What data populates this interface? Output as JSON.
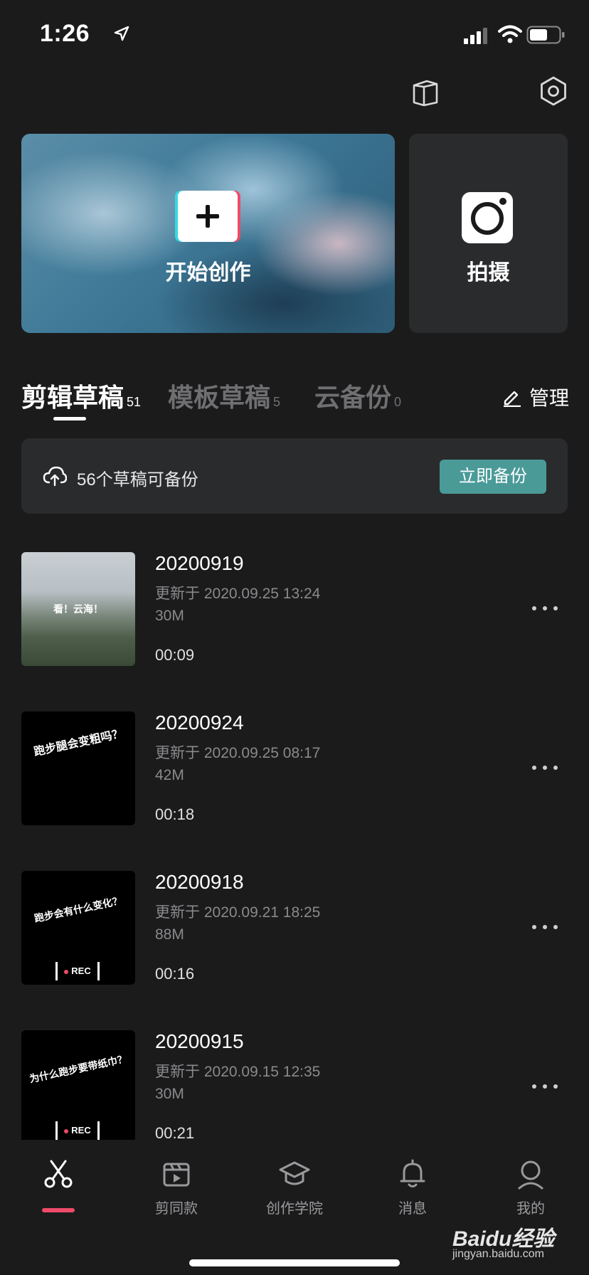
{
  "status_bar": {
    "time": "1:26"
  },
  "hero": {
    "create_label": "开始创作",
    "shoot_label": "拍摄"
  },
  "tabs": [
    {
      "label": "剪辑草稿",
      "count": "51",
      "active": true
    },
    {
      "label": "模板草稿",
      "count": "5",
      "active": false
    },
    {
      "label": "云备份",
      "count": "0",
      "active": false
    }
  ],
  "manage_label": "管理",
  "backup": {
    "text": "56个草稿可备份",
    "button": "立即备份"
  },
  "drafts": [
    {
      "title": "20200919",
      "updated": "更新于 2020.09.25 13:24",
      "size": "30M",
      "duration": "00:09",
      "thumb_text": "看！云海！"
    },
    {
      "title": "20200924",
      "updated": "更新于 2020.09.25 08:17",
      "size": "42M",
      "duration": "00:18",
      "thumb_text": "跑步腿会变粗吗？"
    },
    {
      "title": "20200918",
      "updated": "更新于 2020.09.21 18:25",
      "size": "88M",
      "duration": "00:16",
      "thumb_text": "跑步会有什么变化？",
      "rec": "REC"
    },
    {
      "title": "20200915",
      "updated": "更新于 2020.09.15 12:35",
      "size": "30M",
      "duration": "00:21",
      "thumb_text": "为什么跑步要带纸巾？",
      "rec": "REC"
    }
  ],
  "nav": [
    {
      "label": "",
      "icon": "scissors-icon",
      "active": true
    },
    {
      "label": "剪同款",
      "icon": "clapper-icon"
    },
    {
      "label": "创作学院",
      "icon": "graduation-cap-icon"
    },
    {
      "label": "消息",
      "icon": "bell-icon"
    },
    {
      "label": "我的",
      "icon": "profile-icon"
    }
  ],
  "watermark": {
    "brand": "Baidu经验",
    "domain": "jingyan.baidu.com"
  },
  "colors": {
    "background": "#1b1b1c",
    "card": "#2a2b2d",
    "accent_teal": "#4a9a98",
    "accent_red": "#f04a6a"
  }
}
